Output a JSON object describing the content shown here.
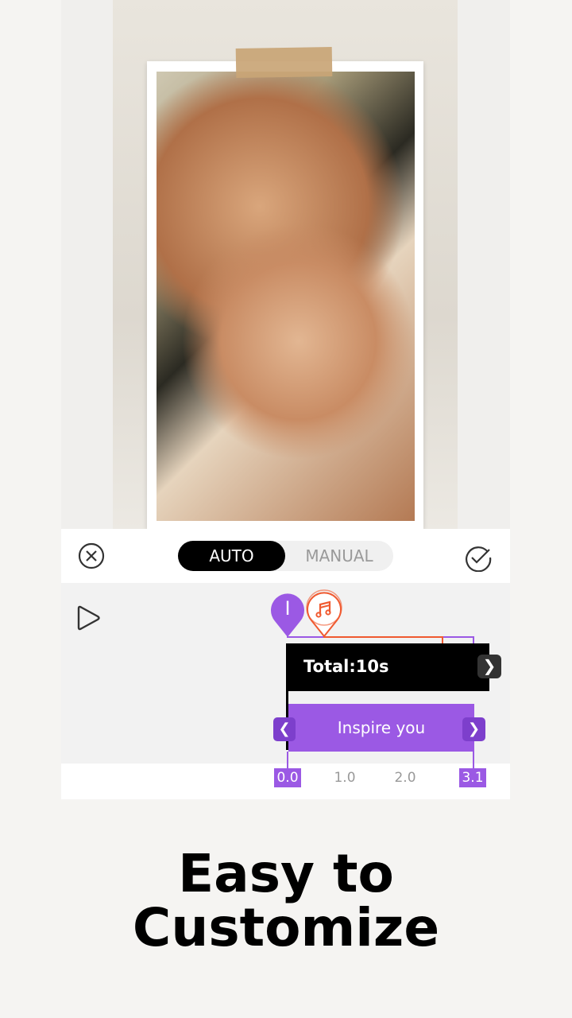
{
  "mode_toggle": {
    "auto": "AUTO",
    "manual": "MANUAL",
    "selected": "AUTO"
  },
  "timeline": {
    "total_label": "Total:10s",
    "text_clip_label": "Inspire you",
    "text_marker_glyph": "I",
    "ticks": [
      "0.0",
      "1.0",
      "2.0",
      "3.1"
    ],
    "colors": {
      "accent_purple": "#9b59e4",
      "music_orange": "#f05a30"
    }
  },
  "icons": {
    "close": "close-circle-icon",
    "confirm": "check-circle-icon",
    "play": "play-icon",
    "music": "music-note-icon"
  },
  "headline": {
    "line1": "Easy to",
    "line2": "Customize"
  }
}
